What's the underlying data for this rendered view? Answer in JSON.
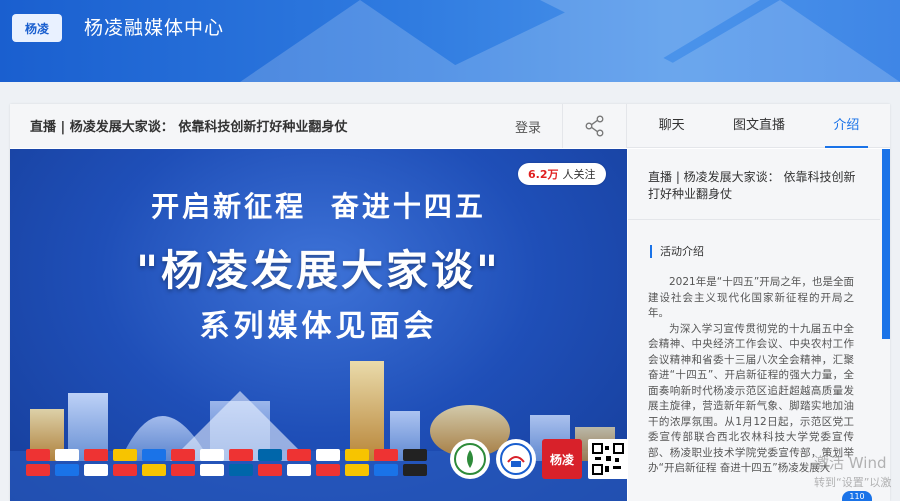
{
  "header": {
    "logo_text": "杨凌",
    "title": "杨凌融媒体中心",
    "bg_color": "#1a5fcf"
  },
  "topbar": {
    "live_title": "直播 | 杨凌发展大家谈：  依靠科技创新打好种业翻身仗",
    "login_label": "登录",
    "share_icon": "share-icon"
  },
  "tabs": [
    {
      "label": "聊天",
      "active": false
    },
    {
      "label": "图文直播",
      "active": false
    },
    {
      "label": "介绍",
      "active": true
    }
  ],
  "poster": {
    "follow_count": "6.2万",
    "follow_label": "人关注",
    "line1": "开启新征程   奋进十四五",
    "line2": "\"杨凌发展大家谈\"",
    "line3": "系列媒体见面会",
    "badge_brand": "杨凌"
  },
  "side": {
    "title": "直播 | 杨凌发展大家谈：  依靠科技创新打好种业翻身仗",
    "section_label": "活动介绍",
    "paragraph1": "2021年是“十四五”开局之年，也是全面建设社会主义现代化国家新征程的开局之年。",
    "paragraph2": "为深入学习宣传贯彻党的十九届五中全会精神、中央经济工作会议、中央农村工作会议精神和省委十三届八次全会精神，汇聚奋进“十四五”、开启新征程的强大力量，全面奏响新时代杨凌示范区追赶超越高质量发展主旋律，营造新年新气象、脚踏实地加油干的浓厚氛围。从1月12日起，示范区党工委宣传部联合西北农林科技大学党委宣传部、杨凌职业技术学院党委宣传部，策划举办“开启新征程  奋进十四五”杨凌发展大"
  },
  "overlay": {
    "watermark_line1": "激活 Wind",
    "watermark_line2": "转到“设置”以激",
    "bubble": "110"
  },
  "accent_color": "#1a73e8"
}
